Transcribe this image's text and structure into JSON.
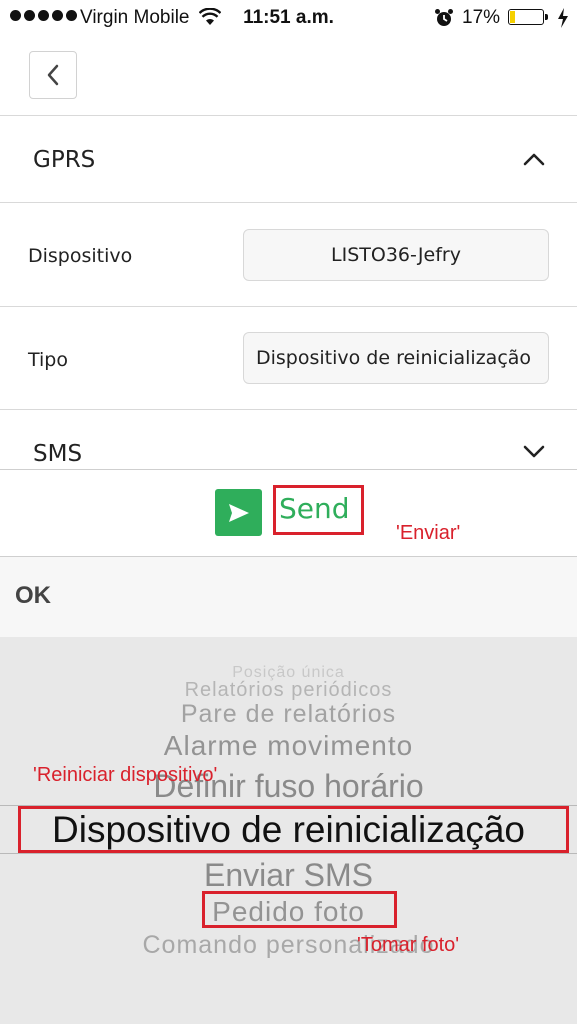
{
  "status_bar": {
    "carrier": "Virgin Mobile",
    "time": "11:51 a.m.",
    "battery_percent": "17%",
    "battery_level": 0.17,
    "battery_color": "#f5d000"
  },
  "nav": {
    "back_icon": "chevron-left-icon"
  },
  "gprs": {
    "title": "GPRS",
    "expanded": true,
    "fields": [
      {
        "label": "Dispositivo",
        "value": "LISTO36-Jefry"
      },
      {
        "label": "Tipo",
        "value": "Dispositivo de reinicialização"
      }
    ]
  },
  "sms": {
    "title": "SMS",
    "expanded": false
  },
  "send": {
    "label": "Send",
    "color": "#2fae5b"
  },
  "ok": {
    "label": "OK"
  },
  "picker": {
    "options": [
      "Posição única",
      "Relatórios periódicos",
      "Pare de relatórios",
      "Alarme movimento",
      "Definir fuso horário",
      "Dispositivo de reinicialização",
      "Enviar SMS",
      "Pedido foto",
      "Comando personalizado"
    ],
    "selected": "Dispositivo de reinicialização"
  },
  "annotations": {
    "color": "#d9212c",
    "send_translation": "'Enviar'",
    "reset_translation": "'Reiniciar dispositivo'",
    "photo_translation": "'Tomar foto'"
  }
}
